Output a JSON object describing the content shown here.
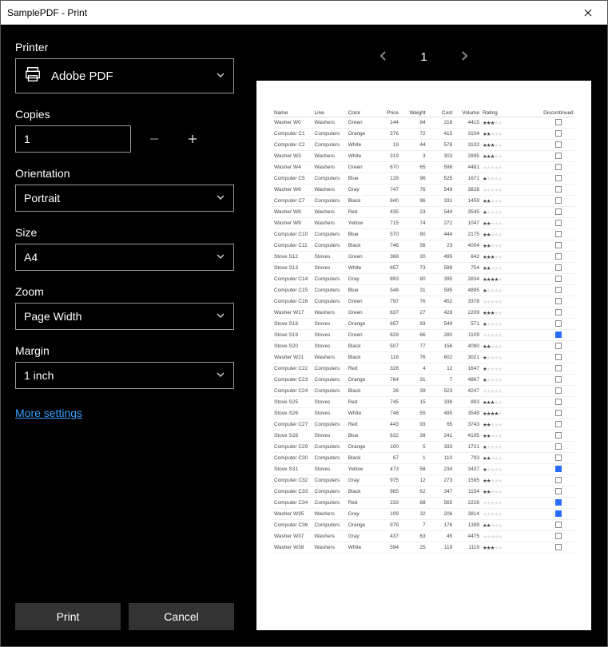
{
  "titlebar": {
    "title": "SamplePDF - Print"
  },
  "sidebar": {
    "printer_label": "Printer",
    "printer_value": "Adobe PDF",
    "copies_label": "Copies",
    "copies_value": "1",
    "orientation_label": "Orientation",
    "orientation_value": "Portrait",
    "size_label": "Size",
    "size_value": "A4",
    "zoom_label": "Zoom",
    "zoom_value": "Page Width",
    "margin_label": "Margin",
    "margin_value": "1 inch",
    "more_settings": "More settings"
  },
  "footer": {
    "print": "Print",
    "cancel": "Cancel"
  },
  "preview": {
    "page_number": "1"
  },
  "table": {
    "headers": [
      "Name",
      "Line",
      "Color",
      "Price",
      "Weight",
      "Cost",
      "Volume",
      "Rating",
      "Discontinued"
    ],
    "rows": [
      {
        "name": "Washer W0",
        "line": "Washers",
        "color": "Green",
        "price": 144,
        "weight": 84,
        "cost": 218,
        "volume": 4415,
        "rating": 3,
        "disc": false
      },
      {
        "name": "Computer C1",
        "line": "Computers",
        "color": "Orange",
        "price": 376,
        "weight": 72,
        "cost": 415,
        "volume": 3104,
        "rating": 2,
        "disc": false
      },
      {
        "name": "Computer C2",
        "line": "Computers",
        "color": "White",
        "price": 19,
        "weight": 44,
        "cost": 578,
        "volume": 3102,
        "rating": 3,
        "disc": false
      },
      {
        "name": "Washer W3",
        "line": "Washers",
        "color": "White",
        "price": 319,
        "weight": 3,
        "cost": 303,
        "volume": 2895,
        "rating": 3,
        "disc": false
      },
      {
        "name": "Washer W4",
        "line": "Washers",
        "color": "Green",
        "price": 670,
        "weight": 65,
        "cost": 596,
        "volume": 4481,
        "rating": 0,
        "disc": false
      },
      {
        "name": "Computer C5",
        "line": "Computers",
        "color": "Blue",
        "price": 128,
        "weight": 96,
        "cost": 525,
        "volume": 1671,
        "rating": 1,
        "disc": false
      },
      {
        "name": "Washer W6",
        "line": "Washers",
        "color": "Gray",
        "price": 747,
        "weight": 76,
        "cost": 549,
        "volume": 3828,
        "rating": 0,
        "disc": false
      },
      {
        "name": "Computer C7",
        "line": "Computers",
        "color": "Black",
        "price": 840,
        "weight": 96,
        "cost": 331,
        "volume": 1459,
        "rating": 2,
        "disc": false
      },
      {
        "name": "Washer W8",
        "line": "Washers",
        "color": "Red",
        "price": 435,
        "weight": 23,
        "cost": 544,
        "volume": 3545,
        "rating": 1,
        "disc": false
      },
      {
        "name": "Washer W9",
        "line": "Washers",
        "color": "Yellow",
        "price": 715,
        "weight": 74,
        "cost": 272,
        "volume": 1047,
        "rating": 2,
        "disc": false
      },
      {
        "name": "Computer C10",
        "line": "Computers",
        "color": "Blue",
        "price": 570,
        "weight": 80,
        "cost": 444,
        "volume": 2175,
        "rating": 2,
        "disc": false
      },
      {
        "name": "Computer C11",
        "line": "Computers",
        "color": "Black",
        "price": 746,
        "weight": 56,
        "cost": 23,
        "volume": 4004,
        "rating": 2,
        "disc": false
      },
      {
        "name": "Stove S12",
        "line": "Stoves",
        "color": "Green",
        "price": 368,
        "weight": 20,
        "cost": 495,
        "volume": 642,
        "rating": 3,
        "disc": false
      },
      {
        "name": "Stove S13",
        "line": "Stoves",
        "color": "White",
        "price": 657,
        "weight": 73,
        "cost": 588,
        "volume": 754,
        "rating": 2,
        "disc": false
      },
      {
        "name": "Computer C14",
        "line": "Computers",
        "color": "Gray",
        "price": 893,
        "weight": 80,
        "cost": 395,
        "volume": 2834,
        "rating": 4,
        "disc": false
      },
      {
        "name": "Computer C15",
        "line": "Computers",
        "color": "Blue",
        "price": 548,
        "weight": 31,
        "cost": 595,
        "volume": 4895,
        "rating": 1,
        "disc": false
      },
      {
        "name": "Computer C16",
        "line": "Computers",
        "color": "Green",
        "price": 797,
        "weight": 76,
        "cost": 452,
        "volume": 3378,
        "rating": 0,
        "disc": false
      },
      {
        "name": "Washer W17",
        "line": "Washers",
        "color": "Green",
        "price": 637,
        "weight": 27,
        "cost": 428,
        "volume": 2209,
        "rating": 3,
        "disc": false
      },
      {
        "name": "Stove S18",
        "line": "Stoves",
        "color": "Orange",
        "price": 657,
        "weight": 93,
        "cost": 549,
        "volume": 571,
        "rating": 1,
        "disc": false
      },
      {
        "name": "Stove S19",
        "line": "Stoves",
        "color": "Green",
        "price": 629,
        "weight": 66,
        "cost": 280,
        "volume": 1109,
        "rating": 0,
        "disc": true
      },
      {
        "name": "Stove S20",
        "line": "Stoves",
        "color": "Black",
        "price": 507,
        "weight": 77,
        "cost": 156,
        "volume": 4090,
        "rating": 2,
        "disc": false
      },
      {
        "name": "Washer W21",
        "line": "Washers",
        "color": "Black",
        "price": 118,
        "weight": 76,
        "cost": 602,
        "volume": 3021,
        "rating": 1,
        "disc": false
      },
      {
        "name": "Computer C22",
        "line": "Computers",
        "color": "Red",
        "price": 328,
        "weight": 4,
        "cost": 12,
        "volume": 1647,
        "rating": 1,
        "disc": false
      },
      {
        "name": "Computer C23",
        "line": "Computers",
        "color": "Orange",
        "price": 764,
        "weight": 31,
        "cost": 7,
        "volume": 4867,
        "rating": 1,
        "disc": false
      },
      {
        "name": "Computer C24",
        "line": "Computers",
        "color": "Black",
        "price": 26,
        "weight": 39,
        "cost": 523,
        "volume": 4247,
        "rating": 0,
        "disc": false
      },
      {
        "name": "Stove S25",
        "line": "Stoves",
        "color": "Red",
        "price": 745,
        "weight": 15,
        "cost": 338,
        "volume": 893,
        "rating": 3,
        "disc": false
      },
      {
        "name": "Stove S26",
        "line": "Stoves",
        "color": "White",
        "price": 748,
        "weight": 55,
        "cost": 495,
        "volume": 3549,
        "rating": 4,
        "disc": false
      },
      {
        "name": "Computer C27",
        "line": "Computers",
        "color": "Red",
        "price": 443,
        "weight": 93,
        "cost": 65,
        "volume": 3743,
        "rating": 2,
        "disc": false
      },
      {
        "name": "Stove S28",
        "line": "Stoves",
        "color": "Blue",
        "price": 632,
        "weight": 39,
        "cost": 241,
        "volume": 4195,
        "rating": 2,
        "disc": false
      },
      {
        "name": "Computer C29",
        "line": "Computers",
        "color": "Orange",
        "price": 100,
        "weight": 5,
        "cost": 333,
        "volume": 1721,
        "rating": 1,
        "disc": false
      },
      {
        "name": "Computer C30",
        "line": "Computers",
        "color": "Black",
        "price": 67,
        "weight": 1,
        "cost": 110,
        "volume": 793,
        "rating": 2,
        "disc": false
      },
      {
        "name": "Stove S31",
        "line": "Stoves",
        "color": "Yellow",
        "price": 473,
        "weight": 58,
        "cost": 234,
        "volume": 3437,
        "rating": 1,
        "disc": true
      },
      {
        "name": "Computer C32",
        "line": "Computers",
        "color": "Gray",
        "price": 975,
        "weight": 12,
        "cost": 273,
        "volume": 1595,
        "rating": 2,
        "disc": false
      },
      {
        "name": "Computer C33",
        "line": "Computers",
        "color": "Black",
        "price": 965,
        "weight": 62,
        "cost": 347,
        "volume": 1154,
        "rating": 2,
        "disc": false
      },
      {
        "name": "Computer C34",
        "line": "Computers",
        "color": "Red",
        "price": 233,
        "weight": 88,
        "cost": 565,
        "volume": 2228,
        "rating": 0,
        "disc": true
      },
      {
        "name": "Washer W35",
        "line": "Washers",
        "color": "Gray",
        "price": 109,
        "weight": 32,
        "cost": 206,
        "volume": 3814,
        "rating": 0,
        "disc": true
      },
      {
        "name": "Computer C36",
        "line": "Computers",
        "color": "Orange",
        "price": 979,
        "weight": 7,
        "cost": 176,
        "volume": 1399,
        "rating": 2,
        "disc": false
      },
      {
        "name": "Washer W37",
        "line": "Washers",
        "color": "Gray",
        "price": 437,
        "weight": 63,
        "cost": 45,
        "volume": 4475,
        "rating": 0,
        "disc": false
      },
      {
        "name": "Washer W38",
        "line": "Washers",
        "color": "White",
        "price": 594,
        "weight": 25,
        "cost": 119,
        "volume": 1119,
        "rating": 3,
        "disc": false
      }
    ]
  }
}
